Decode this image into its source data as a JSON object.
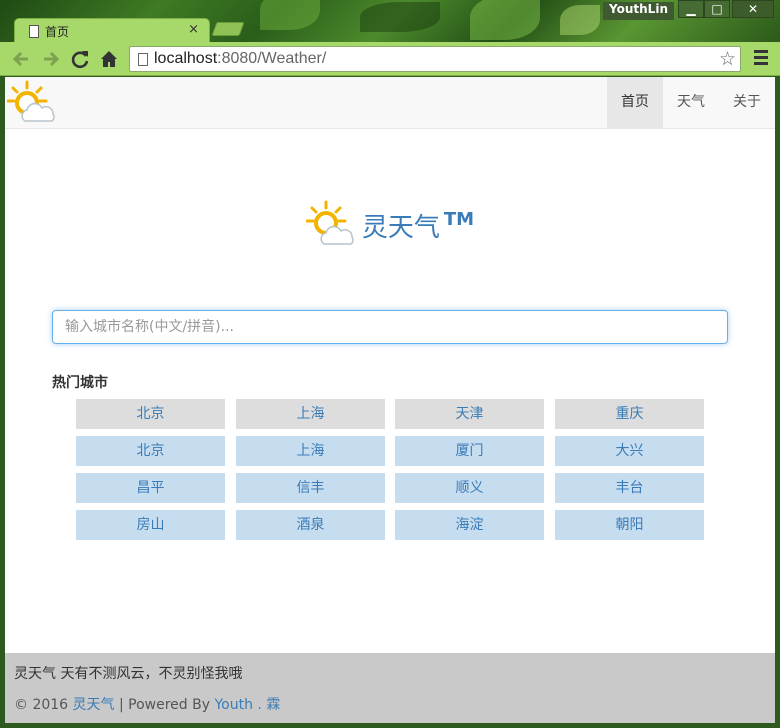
{
  "browser": {
    "tab_title": "首页",
    "tab_close": "×",
    "user_name": "YouthLin",
    "window_buttons": [
      "▁",
      "□",
      "✕"
    ],
    "url_host": "localhost",
    "url_rest": ":8080/Weather/",
    "icons": {
      "back": "back-arrow-icon",
      "forward": "forward-arrow-icon",
      "reload": "reload-icon",
      "home": "home-icon",
      "bookmark": "star-icon",
      "menu": "hamburger-menu-icon"
    },
    "colors": {
      "chrome": "#a6d96a"
    }
  },
  "navbar": {
    "items": [
      {
        "label": "首页",
        "active": true
      },
      {
        "label": "天气",
        "active": false
      },
      {
        "label": "关于",
        "active": false
      }
    ]
  },
  "hero": {
    "title": "灵天气",
    "tm": "TM"
  },
  "search": {
    "placeholder": "输入城市名称(中文/拼音)..."
  },
  "hot_cities": {
    "title": "热门城市",
    "rows": [
      [
        "北京",
        "上海",
        "天津",
        "重庆"
      ],
      [
        "北京",
        "上海",
        "厦门",
        "大兴"
      ],
      [
        "昌平",
        "信丰",
        "顺义",
        "丰台"
      ],
      [
        "房山",
        "酒泉",
        "海淀",
        "朝阳"
      ]
    ],
    "colors": {
      "first_row": "#dddddd",
      "other_rows": "#c6dcef",
      "text": "#3a7cb8"
    }
  },
  "footer": {
    "slogan": "灵天气 天有不测风云，不灵别怪我哦",
    "copyright_prefix": "© 2016 ",
    "site_name": "灵天气",
    "powered_by": " | Powered By ",
    "author_first": "Youth",
    "author_sep": ".",
    "author_last": "霖"
  }
}
